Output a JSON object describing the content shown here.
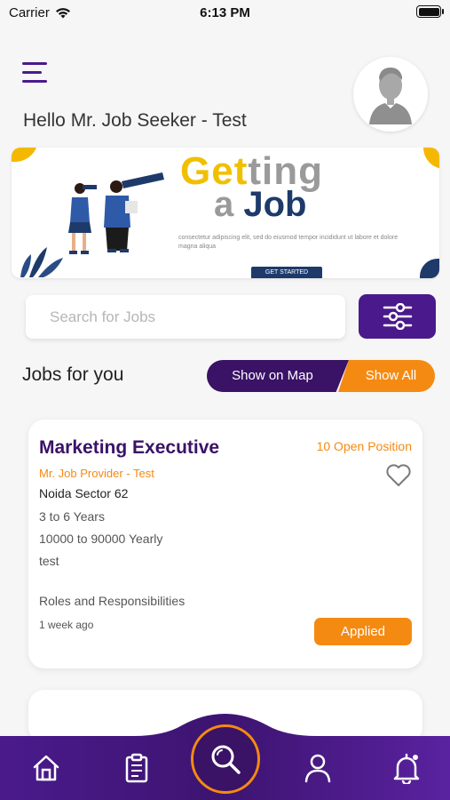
{
  "status_bar": {
    "carrier": "Carrier",
    "time": "6:13 PM"
  },
  "header": {
    "greeting": "Hello Mr. Job Seeker - Test"
  },
  "banner": {
    "title_part1": "Get",
    "title_part2": "ting",
    "title_line2_a": "a ",
    "title_line2_b": "Job",
    "subtitle": "consectetur adipiscing elit, sed do eiusmod tempor incididunt ut labore et dolore magna aliqua",
    "cta_label": "GET STARTED"
  },
  "search": {
    "placeholder": "Search for Jobs"
  },
  "section": {
    "title": "Jobs for you",
    "show_on_map": "Show on Map",
    "show_all": "Show All"
  },
  "jobs": [
    {
      "title": "Marketing Executive",
      "positions": "10 Open Position",
      "company": "Mr. Job Provider - Test",
      "location": "Noida Sector 62",
      "experience": "3 to 6 Years",
      "salary": "10000 to 90000 Yearly",
      "description": "test",
      "roles_label": "Roles and Responsibilities",
      "posted": "1 week ago",
      "status_label": "Applied"
    }
  ],
  "colors": {
    "primary": "#3a1266",
    "accent": "#f58a12"
  },
  "icons": {
    "menu": "menu-icon",
    "filter": "filter-sliders-icon",
    "heart": "heart-icon",
    "home": "home-icon",
    "clipboard": "clipboard-icon",
    "search": "search-icon",
    "profile": "user-icon",
    "notifications": "bell-icon"
  }
}
